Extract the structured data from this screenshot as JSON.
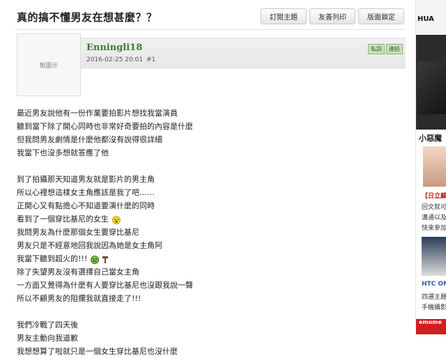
{
  "thread": {
    "title": "真的搞不懂男友在想甚麼？？"
  },
  "toolbar": {
    "subscribe": "訂閱主題",
    "print": "友善列印",
    "lock": "版面鎖定"
  },
  "post": {
    "avatar_placeholder": "無圖示",
    "author": "Enningli18",
    "datetime": "2016-02-25 20:01",
    "floor": "#1",
    "pm": "私訊",
    "quote": "連結"
  },
  "content": {
    "lines": [
      "最近男友說他有一份作業要拍影片想找我當演員",
      "聽到當下除了開心同時也非常好奇要拍的內容是什麼",
      "但我問男友劇情是什麼他都沒有說得很詳細",
      "我當下也沒多想就答應了他",
      "",
      "到了拍攝那天知道男友就是影片的男主角",
      "所以心裡想這樣女主角應該是我了吧……",
      "正開心又有點擔心不知道要演什麼的同時",
      "看到了一個穿比基尼的女生",
      "我問男友為什麼那個女生要穿比基尼",
      "男友只是不經意地回我說因為她是女主角阿",
      "我當下聽到超火的!!!",
      "除了失望男友沒有選擇自己當女主角",
      "一方面又覺得為什麼有人要穿比基尼也沒跟我說一聲",
      "所以不顧男友的阻攔我就直接走了!!!",
      "",
      "我們冷戰了四天後",
      "男友主動向我道歉",
      "我想想算了啦就只是一個女生穿比基尼也沒什麼"
    ],
    "emoticons": {
      "8": "shock-emoticon",
      "11": "angry-emoticon"
    }
  },
  "sidebar": {
    "ad_brand": "HUA",
    "headline": "小惡魔",
    "links": [
      "【日立顧",
      "回文就可",
      "溝通以及",
      "快來參加"
    ],
    "links2": [
      "HTC ON",
      "四選主題",
      "手機攝影"
    ],
    "bottom_bar": "emome"
  },
  "colors": {
    "author": "#3f7a34",
    "post_button_bg": "#c9e2bd",
    "ad_red": "#d31c1c"
  }
}
